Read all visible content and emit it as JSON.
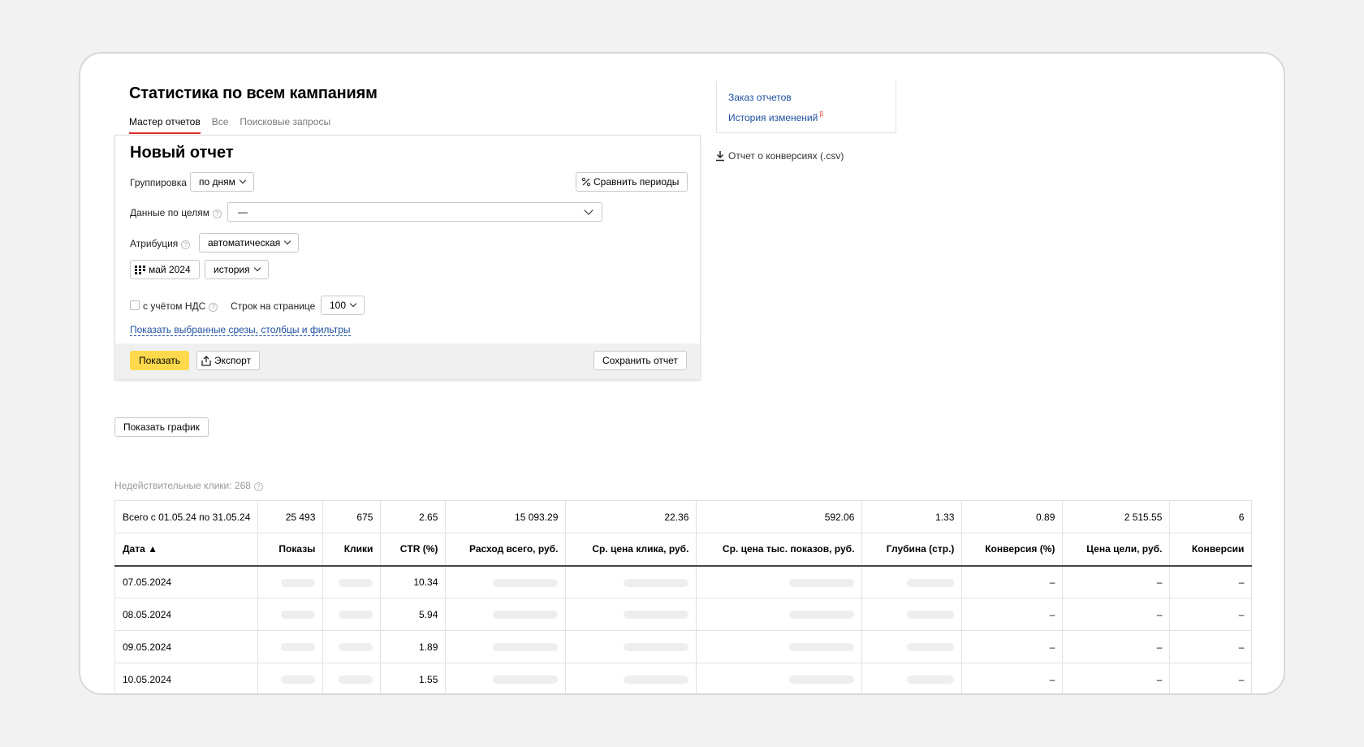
{
  "page_title": "Статистика по всем кампаниям",
  "tabs": [
    {
      "label": "Мастер отчетов",
      "active": true
    },
    {
      "label": "Все",
      "active": false
    },
    {
      "label": "Поисковые запросы",
      "active": false
    }
  ],
  "report": {
    "title": "Новый отчет",
    "grouping_label": "Группировка",
    "grouping_value": "по дням",
    "compare_label": "Сравнить периоды",
    "goals_label": "Данные по целям",
    "goals_value": "—",
    "attribution_label": "Атрибуция",
    "attribution_value": "автоматическая",
    "period_value": "май 2024",
    "history_value": "история",
    "vat_label": "с учётом НДС",
    "rows_label": "Строк на странице",
    "rows_value": "100",
    "show_selected_link": "Показать выбранные срезы, столбцы и фильтры",
    "show_button": "Показать",
    "export_button": "Экспорт",
    "save_button": "Сохранить отчет"
  },
  "sidebar": {
    "order_reports": "Заказ отчетов",
    "change_history": "История изменений",
    "beta": "β",
    "conversion_report": "Отчет о конверсиях (.csv)"
  },
  "show_chart_button": "Показать график",
  "invalid_clicks": "Недействительные клики: 268",
  "table": {
    "total_label": "Всего с 01.05.24 по 31.05.24",
    "totals": [
      "25 493",
      "675",
      "2.65",
      "15 093.29",
      "22.36",
      "592.06",
      "1.33",
      "0.89",
      "2 515.55",
      "6"
    ],
    "headers": [
      "Дата ▲",
      "Показы",
      "Клики",
      "CTR (%)",
      "Расход всего, руб.",
      "Ср. цена клика, руб.",
      "Ср. цена тыс. показов, руб.",
      "Глубина (стр.)",
      "Конверсия (%)",
      "Цена цели, руб.",
      "Конверсии"
    ],
    "rows": [
      {
        "date": "07.05.2024",
        "ctr": "10.34",
        "conv_pct": "–",
        "goal_price": "–",
        "conversions": "–"
      },
      {
        "date": "08.05.2024",
        "ctr": "5.94",
        "conv_pct": "–",
        "goal_price": "–",
        "conversions": "–"
      },
      {
        "date": "09.05.2024",
        "ctr": "1.89",
        "conv_pct": "–",
        "goal_price": "–",
        "conversions": "–"
      },
      {
        "date": "10.05.2024",
        "ctr": "1.55",
        "conv_pct": "–",
        "goal_price": "–",
        "conversions": "–"
      }
    ]
  },
  "colors": {
    "accent_yellow": "#fdd94b",
    "link_blue": "#1e4fa0",
    "tab_underline": "#e0322b"
  }
}
